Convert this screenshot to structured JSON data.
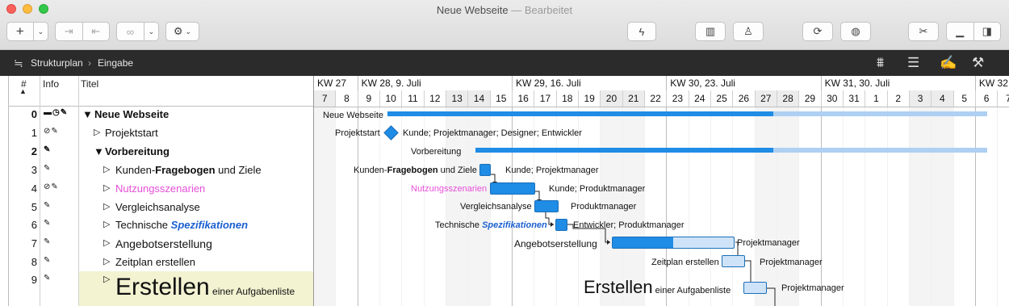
{
  "window": {
    "title": "Neue Webseite",
    "title_sep": " — ",
    "status": "Bearbeitet"
  },
  "pathbar": {
    "crumb1": "Strukturplan",
    "crumb2": "Eingabe"
  },
  "columns": {
    "num": "#",
    "info": "Info",
    "title": "Titel"
  },
  "weeks": [
    "KW 27",
    "KW 28, 9. Juli",
    "KW 29, 16. Juli",
    "KW 30, 23. Juli",
    "KW 31, 30. Juli",
    "KW 32"
  ],
  "days": [
    "7",
    "8",
    "9",
    "10",
    "11",
    "12",
    "13",
    "14",
    "15",
    "16",
    "17",
    "18",
    "19",
    "20",
    "21",
    "22",
    "23",
    "24",
    "25",
    "26",
    "27",
    "28",
    "29",
    "30",
    "31",
    "1",
    "2",
    "3",
    "4",
    "5",
    "6",
    "7"
  ],
  "rows": [
    {
      "num": "0",
      "info": "▬◷✎",
      "title": "Neue Webseite",
      "gantt_label": "Neue Webseite"
    },
    {
      "num": "1",
      "info": "⊘✎",
      "title": "Projektstart",
      "gantt_label": "Projektstart",
      "resources": "Kunde; Projektmanager; Designer; Entwickler"
    },
    {
      "num": "2",
      "info": "✎",
      "title": "Vorbereitung",
      "gantt_label": "Vorbereitung"
    },
    {
      "num": "3",
      "info": "✎",
      "title_a": "Kunden-",
      "title_b": "Fragebogen",
      "title_c": " und Ziele",
      "resources": "Kunde; Projektmanager"
    },
    {
      "num": "4",
      "info": "⊘✎",
      "title": "Nutzungsszenarien",
      "gantt_label": "Nutzungsszenarien",
      "resources": "Kunde; Produktmanager"
    },
    {
      "num": "5",
      "info": "✎",
      "title": "Vergleichsanalyse",
      "gantt_label": "Vergleichsanalyse",
      "resources": "Produktmanager"
    },
    {
      "num": "6",
      "info": "✎",
      "title_a": "Technische ",
      "title_b": "Spezifikationen",
      "resources": "Entwickler; Produktmanager"
    },
    {
      "num": "7",
      "info": "✎",
      "title": "Angebotserstellung",
      "gantt_label": "Angebotserstellung",
      "resources": "Projektmanager",
      "progress": 0.5
    },
    {
      "num": "8",
      "info": "✎",
      "title": "Zeitplan erstellen",
      "gantt_label": "Zeitplan erstellen",
      "resources": "Projektmanager"
    },
    {
      "num": "9",
      "info": "✎",
      "title_big": "Erstellen",
      "title_small": " einer Aufgabenliste",
      "resources": "Projektmanager"
    }
  ],
  "colors": {
    "accent": "#1f8ce6",
    "pink": "#e64fd8",
    "blue_italic": "#1a5fd0",
    "note_bg": "#f3f3d2"
  }
}
